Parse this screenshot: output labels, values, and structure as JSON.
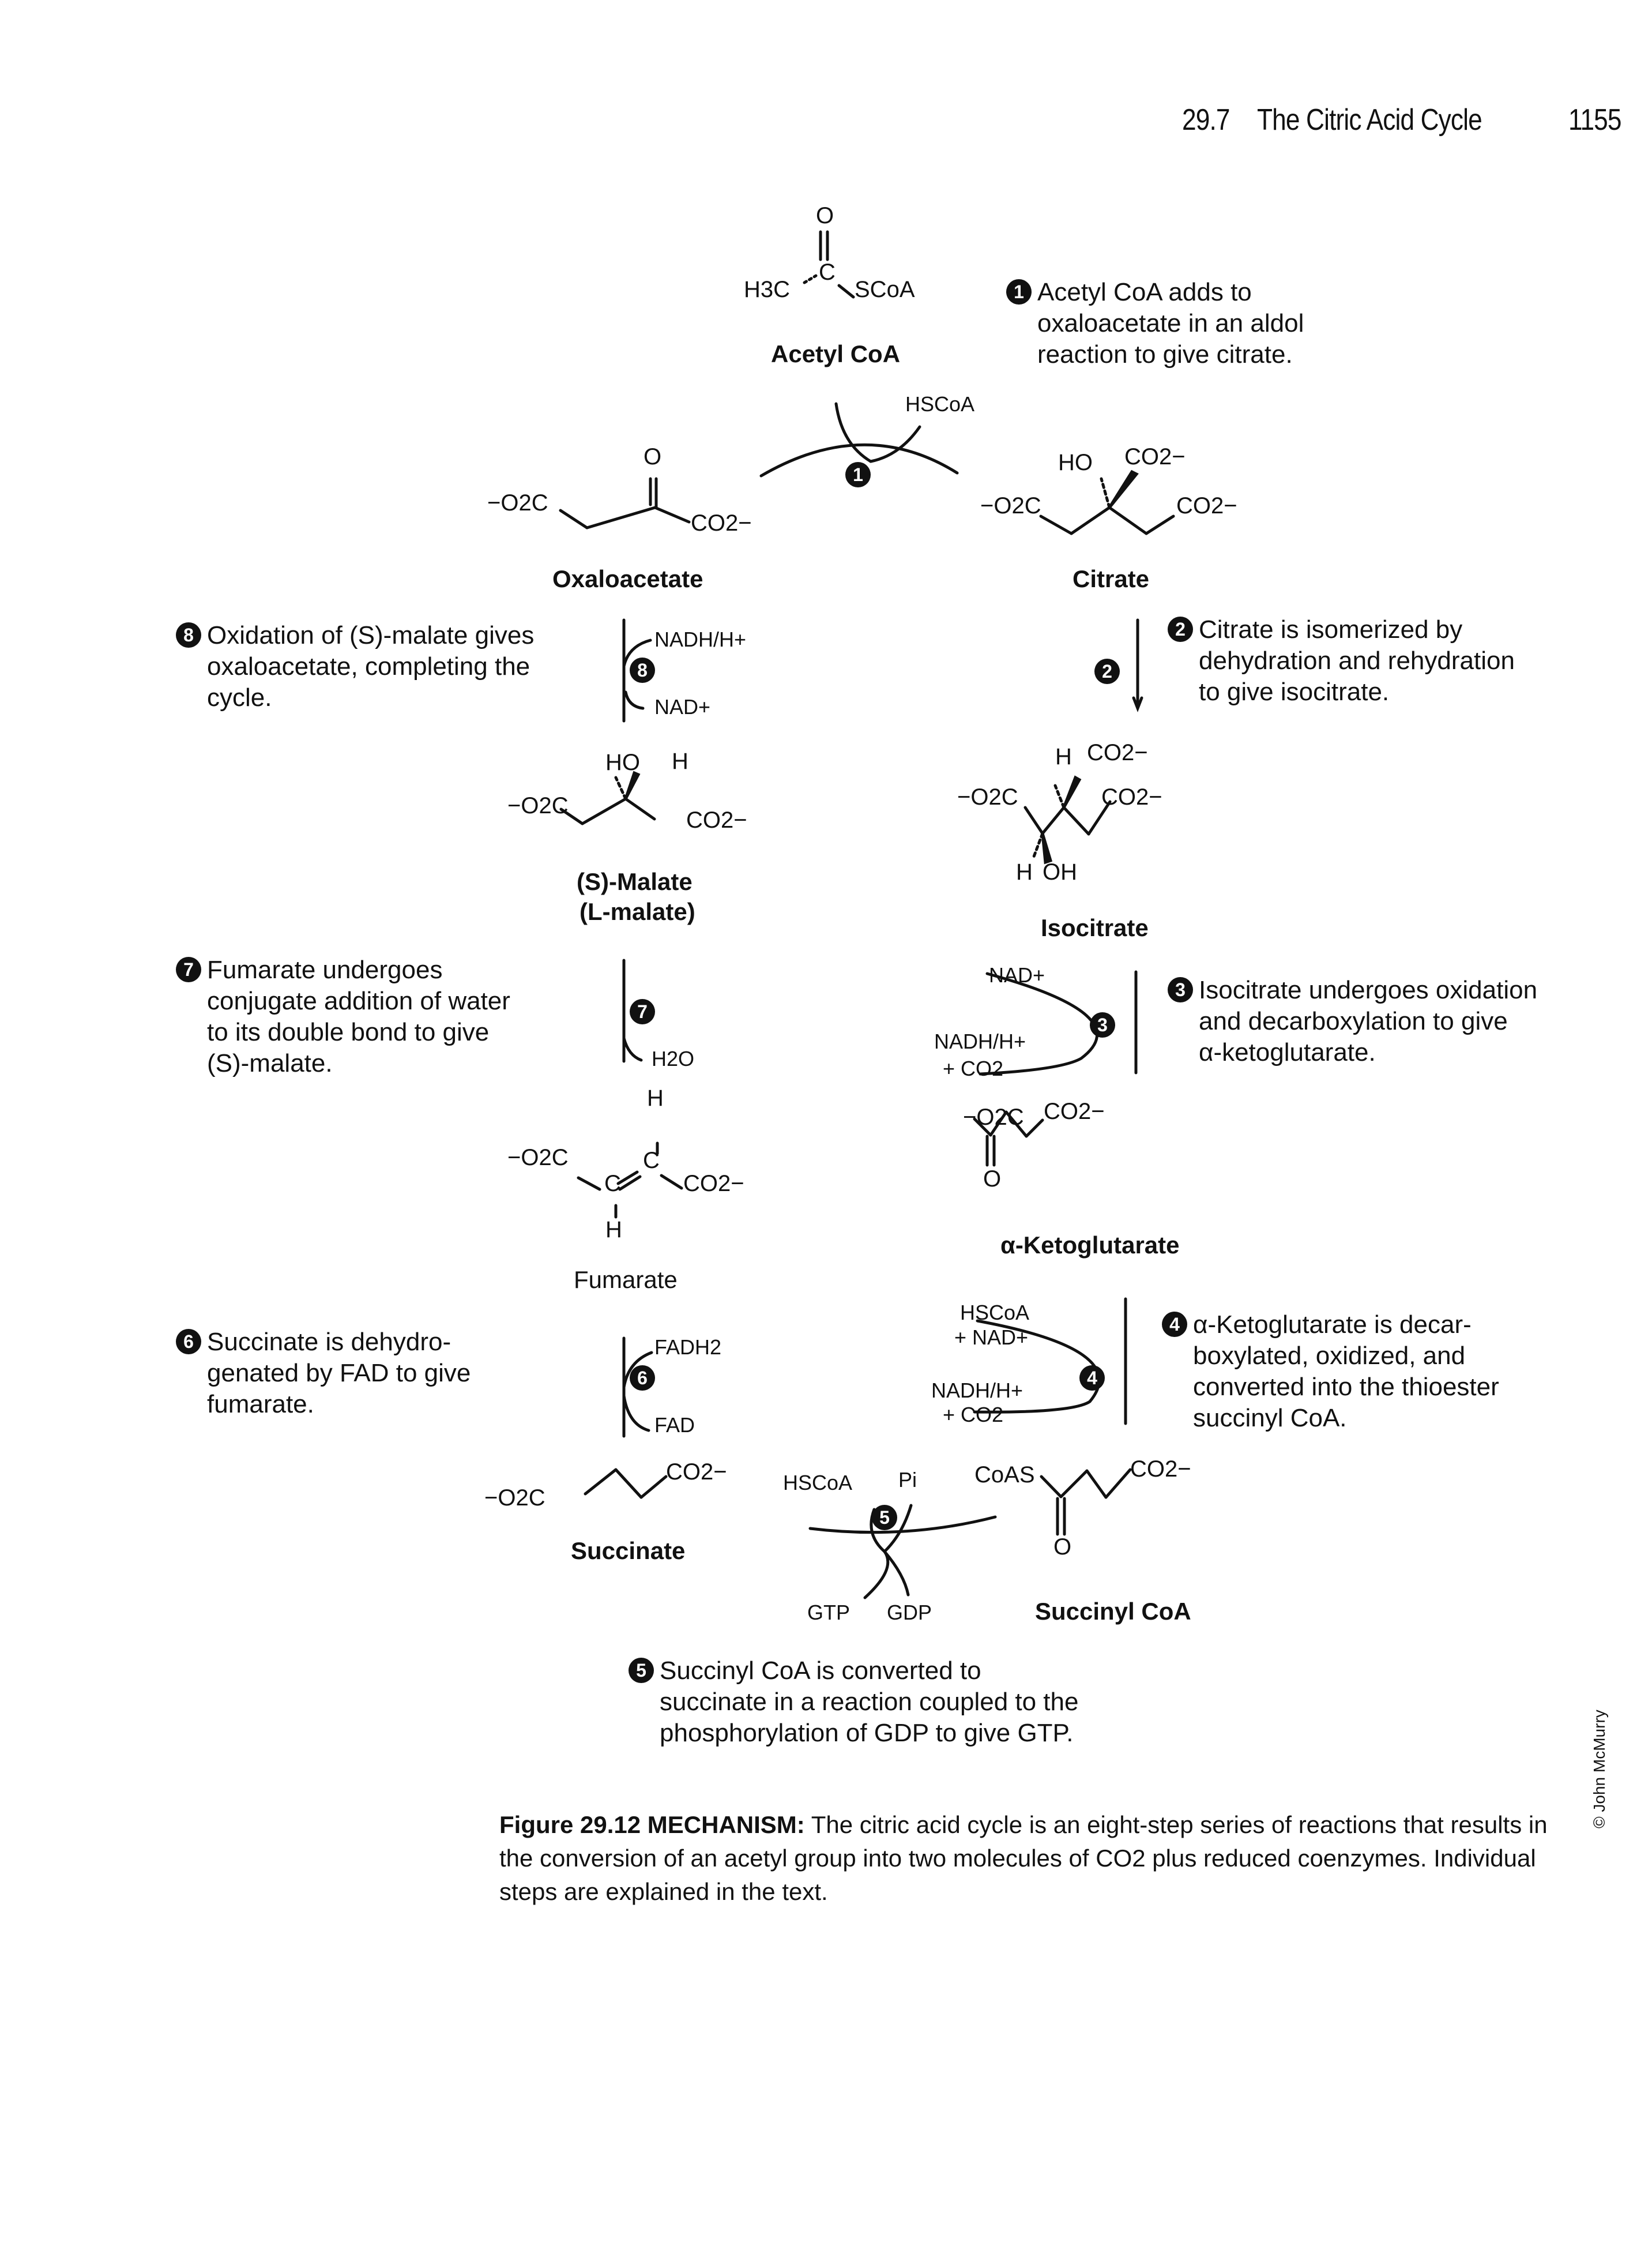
{
  "header": {
    "section": "29.7",
    "title": "The Citric Acid Cycle",
    "page": "1155"
  },
  "molecules": {
    "acetyl_coa": {
      "name": "Acetyl CoA",
      "o": "O",
      "c": "C",
      "h3c": "H3C",
      "scoa": "SCoA"
    },
    "oxaloacetate": {
      "name": "Oxaloacetate",
      "left": "−O2C",
      "right": "CO2−",
      "o": "O"
    },
    "citrate": {
      "name": "Citrate",
      "left": "−O2C",
      "right": "CO2−",
      "ho": "HO",
      "top_co2": "CO2−"
    },
    "isocitrate": {
      "name": "Isocitrate",
      "left": "−O2C",
      "right": "CO2−",
      "h_top": "H",
      "top_co2": "CO2−",
      "h_bottom": "H",
      "oh": "OH"
    },
    "ketoglutarate": {
      "name": "α-Ketoglutarate",
      "left": "−O2C",
      "right": "CO2−",
      "o": "O"
    },
    "succinyl_coa": {
      "name": "Succinyl CoA",
      "left": "CoAS",
      "right": "CO2−",
      "o": "O"
    },
    "succinate": {
      "name": "Succinate",
      "left": "−O2C",
      "right": "CO2−"
    },
    "fumarate": {
      "name": "Fumarate",
      "left": "−O2C",
      "right": "CO2−",
      "c": "C",
      "h": "H"
    },
    "malate": {
      "name": "(S)-Malate",
      "alt_name": "(L-malate)",
      "left": "−O2C",
      "right": "CO2−",
      "ho": "HO",
      "h": "H"
    }
  },
  "reagents": {
    "step1": {
      "out": "HSCoA"
    },
    "step3": {
      "in": "NAD+",
      "out1": "NADH/H+",
      "out2": "+ CO2"
    },
    "step4": {
      "in1": "HSCoA",
      "in2": "+ NAD+",
      "out1": "NADH/H+",
      "out2": "+ CO2"
    },
    "step5": {
      "out1": "HSCoA",
      "in1": "Pi",
      "out2": "GTP",
      "in2": "GDP"
    },
    "step6": {
      "out": "FADH2",
      "in": "FAD"
    },
    "step7": {
      "in": "H2O"
    },
    "step8": {
      "out": "NADH/H+",
      "in": "NAD+"
    }
  },
  "steps": [
    {
      "num": "1",
      "lines": [
        "Acetyl CoA adds to",
        "oxaloacetate in an aldol",
        "reaction to give citrate."
      ]
    },
    {
      "num": "2",
      "lines": [
        "Citrate is isomerized by",
        "dehydration and rehydration",
        "to give isocitrate."
      ]
    },
    {
      "num": "3",
      "lines": [
        "Isocitrate undergoes oxidation",
        "and decarboxylation to give",
        "α-ketoglutarate."
      ]
    },
    {
      "num": "4",
      "lines": [
        "α-Ketoglutarate is decar-",
        "boxylated, oxidized, and",
        "converted into the thioester",
        "succinyl CoA."
      ]
    },
    {
      "num": "5",
      "lines": [
        "Succinyl CoA is converted to",
        "succinate in a reaction coupled to the",
        "phosphorylation of GDP to give GTP."
      ]
    },
    {
      "num": "6",
      "lines": [
        "Succinate is dehydro-",
        "genated by FAD to give",
        "fumarate."
      ]
    },
    {
      "num": "7",
      "lines": [
        "Fumarate undergoes",
        "conjugate addition of water",
        "to its double bond to give",
        "(S)-malate."
      ]
    },
    {
      "num": "8",
      "lines": [
        "Oxidation of (S)-malate gives",
        "oxaloacetate, completing the",
        "cycle."
      ]
    }
  ],
  "caption": {
    "label": "Figure 29.12",
    "keyword": "MECHANISM:",
    "text": "The citric acid cycle is an eight-step series of reactions that results in the conversion of an acetyl group into two molecules of CO2 plus reduced coenzymes. Individual steps are explained in the text."
  },
  "copyright": "© John McMurry"
}
